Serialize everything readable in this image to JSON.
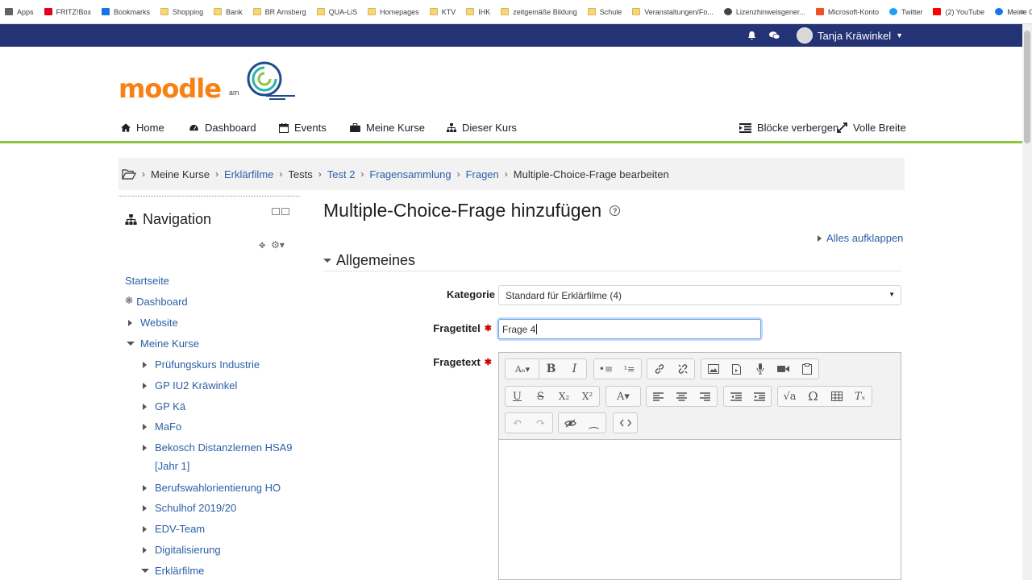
{
  "bookmarks": [
    {
      "label": "Apps",
      "icon": "apps-grid-icon",
      "color": "#5f6368"
    },
    {
      "label": "FRITZ!Box",
      "icon": "fritzbox-icon",
      "color": "#e2001a"
    },
    {
      "label": "Bookmarks",
      "icon": "star-icon",
      "color": "#1a73e8"
    },
    {
      "label": "Shopping",
      "icon": "folder-icon",
      "color": "#f6d67a"
    },
    {
      "label": "Bank",
      "icon": "folder-icon",
      "color": "#f6d67a"
    },
    {
      "label": "BR Arnsberg",
      "icon": "folder-icon",
      "color": "#f6d67a"
    },
    {
      "label": "QUA-LiS",
      "icon": "folder-icon",
      "color": "#f6d67a"
    },
    {
      "label": "Homepages",
      "icon": "folder-icon",
      "color": "#f6d67a"
    },
    {
      "label": "KTV",
      "icon": "folder-icon",
      "color": "#f6d67a"
    },
    {
      "label": "IHK",
      "icon": "folder-icon",
      "color": "#f6d67a"
    },
    {
      "label": "zeitgemäße Bildung",
      "icon": "folder-icon",
      "color": "#f6d67a"
    },
    {
      "label": "Schule",
      "icon": "folder-icon",
      "color": "#f6d67a"
    },
    {
      "label": "Veranstaltungen/Fo...",
      "icon": "folder-icon",
      "color": "#f6d67a"
    },
    {
      "label": "Lizenzhinweisgener...",
      "icon": "globe-icon",
      "color": "#444444"
    },
    {
      "label": "Microsoft-Konto",
      "icon": "microsoft-icon",
      "color": "#f25022"
    },
    {
      "label": "Twitter",
      "icon": "twitter-icon",
      "color": "#1da1f2"
    },
    {
      "label": "(2) YouTube",
      "icon": "youtube-icon",
      "color": "#ff0000"
    },
    {
      "label": "Meine Gesundheit",
      "icon": "health-icon",
      "color": "#1a73e8"
    }
  ],
  "bookmarks_more": "»",
  "navbar": {
    "user_name": "Tanja Kräwinkel",
    "bg_color": "#243375"
  },
  "logo": {
    "wordmark": "moodle",
    "connector": "am"
  },
  "primary_nav": [
    {
      "label": "Home",
      "icon": "home-icon"
    },
    {
      "label": "Dashboard",
      "icon": "dashboard-icon"
    },
    {
      "label": "Events",
      "icon": "calendar-icon"
    },
    {
      "label": "Meine Kurse",
      "icon": "briefcase-icon"
    },
    {
      "label": "Dieser Kurs",
      "icon": "sitemap-icon"
    }
  ],
  "nav_right": {
    "hide_blocks": "Blöcke verbergen",
    "full_width": "Volle Breite"
  },
  "breadcrumb": [
    {
      "label": "Meine Kurse",
      "link": false
    },
    {
      "label": "Erklärfilme",
      "link": true
    },
    {
      "label": "Tests",
      "link": false
    },
    {
      "label": "Test 2",
      "link": true
    },
    {
      "label": "Fragensammlung",
      "link": true
    },
    {
      "label": "Fragen",
      "link": true
    },
    {
      "label": "Multiple-Choice-Frage bearbeiten",
      "link": false
    }
  ],
  "navigation_block": {
    "title": "Navigation",
    "items": [
      {
        "label": "Startseite",
        "indent": 0,
        "marker": "none"
      },
      {
        "label": "Dashboard",
        "indent": 0,
        "marker": "dashboard"
      },
      {
        "label": "Website",
        "indent": 0,
        "marker": "collapsed"
      },
      {
        "label": "Meine Kurse",
        "indent": 0,
        "marker": "expanded"
      },
      {
        "label": "Prüfungskurs Industrie",
        "indent": 1,
        "marker": "collapsed"
      },
      {
        "label": "GP IU2 Kräwinkel",
        "indent": 1,
        "marker": "collapsed"
      },
      {
        "label": "GP Kä",
        "indent": 1,
        "marker": "collapsed"
      },
      {
        "label": "MaFo",
        "indent": 1,
        "marker": "collapsed"
      },
      {
        "label": "Bekosch Distanzlernen HSA9 [Jahr 1]",
        "indent": 1,
        "marker": "collapsed"
      },
      {
        "label": "Berufswahlorientierung HO",
        "indent": 1,
        "marker": "collapsed"
      },
      {
        "label": "Schulhof 2019/20",
        "indent": 1,
        "marker": "collapsed"
      },
      {
        "label": "EDV-Team",
        "indent": 1,
        "marker": "collapsed"
      },
      {
        "label": "Digitalisierung",
        "indent": 1,
        "marker": "collapsed"
      },
      {
        "label": "Erklärfilme",
        "indent": 1,
        "marker": "expanded"
      }
    ]
  },
  "main": {
    "title": "Multiple-Choice-Frage hinzufügen",
    "expand_all": "Alles aufklappen",
    "section": "Allgemeines",
    "fields": {
      "category_label": "Kategorie",
      "category_value": "Standard für Erklärfilme (4)",
      "title_label": "Fragetitel",
      "title_value": "Frage 4",
      "text_label": "Fragetext"
    }
  },
  "colors": {
    "link": "#2c5fa7",
    "accent_green": "#8cc63f",
    "moodle_orange": "#f98012",
    "required": "#cc0000"
  }
}
